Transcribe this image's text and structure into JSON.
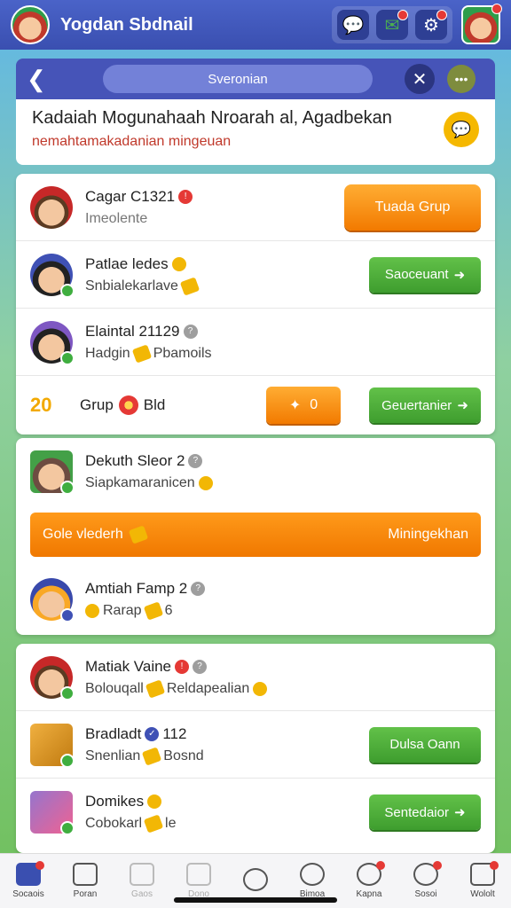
{
  "app": {
    "title": "Yogdan Sbdnail"
  },
  "top_icons": [
    {
      "name": "chat-bubble-icon",
      "glyph": "💬",
      "badge": false
    },
    {
      "name": "message-icon",
      "glyph": "✉",
      "badge": true
    },
    {
      "name": "gear-icon",
      "glyph": "⚙",
      "badge": true
    }
  ],
  "dialog": {
    "search_placeholder": "Sveronian",
    "title": "Kadaiah Mogunahaah Nroarah al, Agadbekan",
    "subtitle": "nemahtamakadanian mingeuan"
  },
  "rows": [
    {
      "name": "Cagar C1321",
      "sub": "Imeolente",
      "button": "Tuada Grup"
    },
    {
      "name": "Patlae ledes",
      "sub": "Snbialekarlave",
      "button": "Saoceuant"
    },
    {
      "name": "Elaintal 21129",
      "sub": "Hadgin",
      "sub2": "Pbamoils"
    }
  ],
  "group": {
    "number": "20",
    "label": "Grup",
    "label2": "Bld",
    "pill": "0",
    "button": "Geuertanier"
  },
  "section2": [
    {
      "name": "Dekuth Sleor 2",
      "sub": "Siapkamaranicen"
    }
  ],
  "banner": {
    "left": "Gole vlederh",
    "right": "Miningekhan"
  },
  "section3": [
    {
      "name": "Amtiah Famp 2",
      "sub": "Rarap",
      "sub2": "6"
    }
  ],
  "section4": [
    {
      "name": "Matiak Vaine",
      "sub": "Bolouqall",
      "sub2": "Reldapealian"
    },
    {
      "name": "Bradladt",
      "name_tag": "112",
      "sub": "Snenlian",
      "sub2": "Bosnd",
      "button": "Dulsa Oann"
    },
    {
      "name": "Domikes",
      "sub": "Cobokarl",
      "sub2": "le",
      "button": "Sentedaior"
    }
  ],
  "tabs": [
    {
      "label": "Socaois",
      "active": true,
      "badge": true
    },
    {
      "label": "Poran",
      "active": false,
      "badge": false
    },
    {
      "label": "Gaos",
      "active": false,
      "badge": false,
      "faded": true
    },
    {
      "label": "Dono",
      "active": false,
      "badge": false,
      "faded": true
    },
    {
      "label": "",
      "active": false,
      "badge": false
    },
    {
      "label": "Bimoa",
      "active": false,
      "badge": false
    },
    {
      "label": "Kapna",
      "active": false,
      "badge": true
    },
    {
      "label": "Sosoi",
      "active": false,
      "badge": true
    },
    {
      "label": "Wololt",
      "active": false,
      "badge": true
    }
  ],
  "colors": {
    "header": "#3a4fb0",
    "accent_orange": "#f27a00",
    "accent_green": "#3e9d2e",
    "badge_red": "#e53935"
  }
}
